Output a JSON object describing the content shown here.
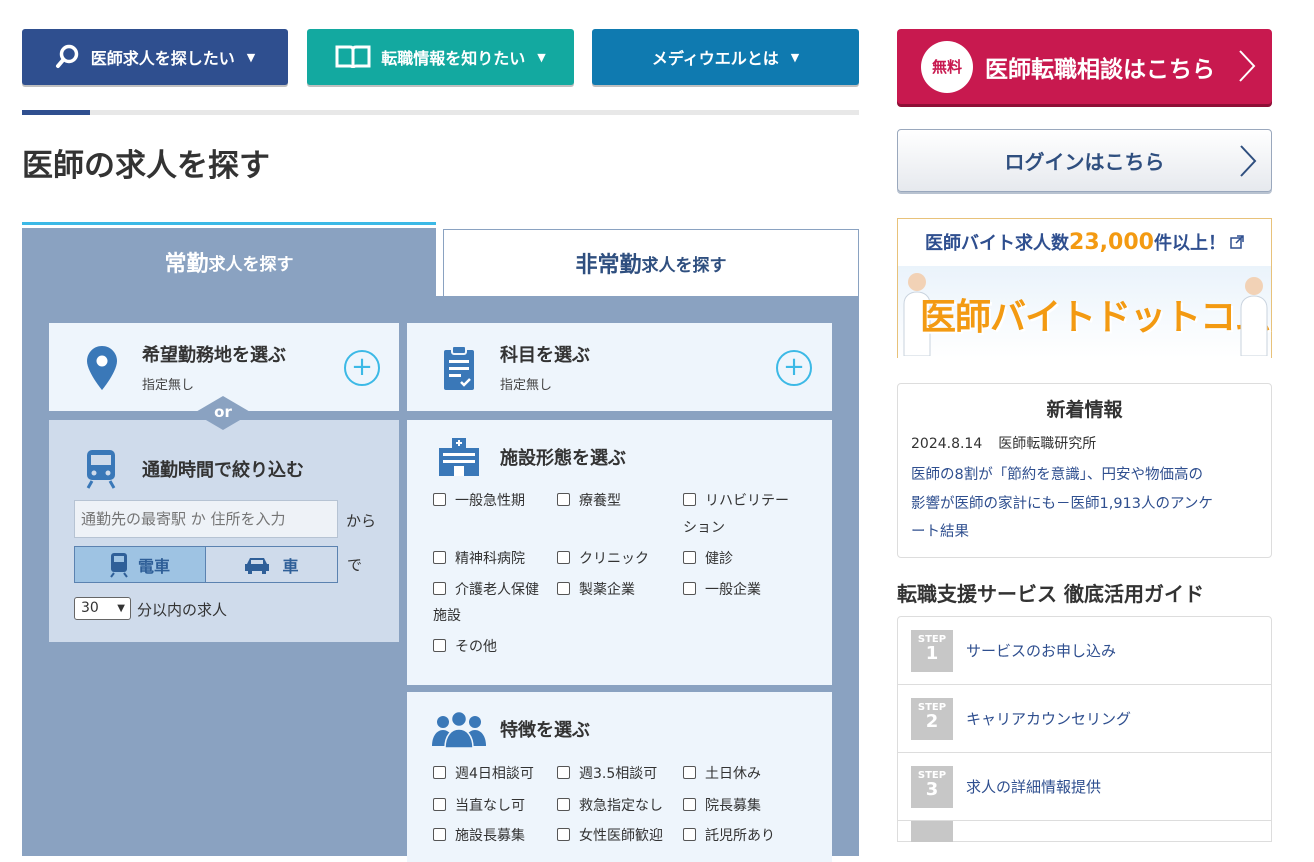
{
  "nav": {
    "search_jobs": "医師求人を探したい",
    "career_info": "転職情報を知りたい",
    "about": "メディウエルとは"
  },
  "cta": {
    "free_badge": "無料",
    "consult": "医師転職相談はこちら",
    "login": "ログインはこちら"
  },
  "page": {
    "title": "医師の求人を探す"
  },
  "tabs": {
    "fulltime_big": "常勤",
    "fulltime_small": "求人を探す",
    "parttime_big": "非常勤",
    "parttime_small": "求人を探す"
  },
  "location": {
    "title": "希望勤務地を選ぶ",
    "sub": "指定無し",
    "or": "or"
  },
  "department": {
    "title": "科目を選ぶ",
    "sub": "指定無し"
  },
  "commute": {
    "title": "通勤時間で絞り込む",
    "placeholder": "通勤先の最寄駅 か 住所を入力",
    "from": "から",
    "train": "電車",
    "car": "車",
    "de": "で",
    "minutes": "30",
    "within": "分以内の求人"
  },
  "facility": {
    "title": "施設形態を選ぶ",
    "options": [
      "一般急性期",
      "療養型",
      "リハビリテー",
      "ション",
      "精神科病院",
      "クリニック",
      "健診",
      "介護老人保健",
      "施設",
      "製薬企業",
      "一般企業",
      "その他"
    ]
  },
  "features": {
    "title": "特徴を選ぶ",
    "options": [
      "週4日相談可",
      "週3.5相談可",
      "土日休み",
      "当直なし可",
      "救急指定なし",
      "院長募集",
      "施設長募集",
      "女性医師歓迎",
      "託児所あり"
    ]
  },
  "banner": {
    "text1": "医師バイト求人数",
    "count": "23,000",
    "text2": "件以上！",
    "logo": "医師バイトドットコム"
  },
  "news": {
    "heading": "新着情報",
    "date": "2024.8.14",
    "source": "医師転職研究所",
    "line1": "医師の8割が「節約を意識」、円安や物価高の",
    "line2": "影響が医師の家計にも－医師1,913人のアンケ",
    "line3": "ート結果"
  },
  "guide": {
    "heading": "転職支援サービス 徹底活用ガイド",
    "step_label": "STEP",
    "steps": [
      {
        "num": "1",
        "label": "サービスのお申し込み"
      },
      {
        "num": "2",
        "label": "キャリアカウンセリング"
      },
      {
        "num": "3",
        "label": "求人の詳細情報提供"
      }
    ]
  },
  "colors": {
    "navy": "#2f4f8f",
    "teal": "#13a9a0",
    "blue": "#0f7ab0",
    "crimson": "#c8194f",
    "panel": "#8aa2c1",
    "accent": "#3cb9e6",
    "orange": "#f39a12"
  }
}
